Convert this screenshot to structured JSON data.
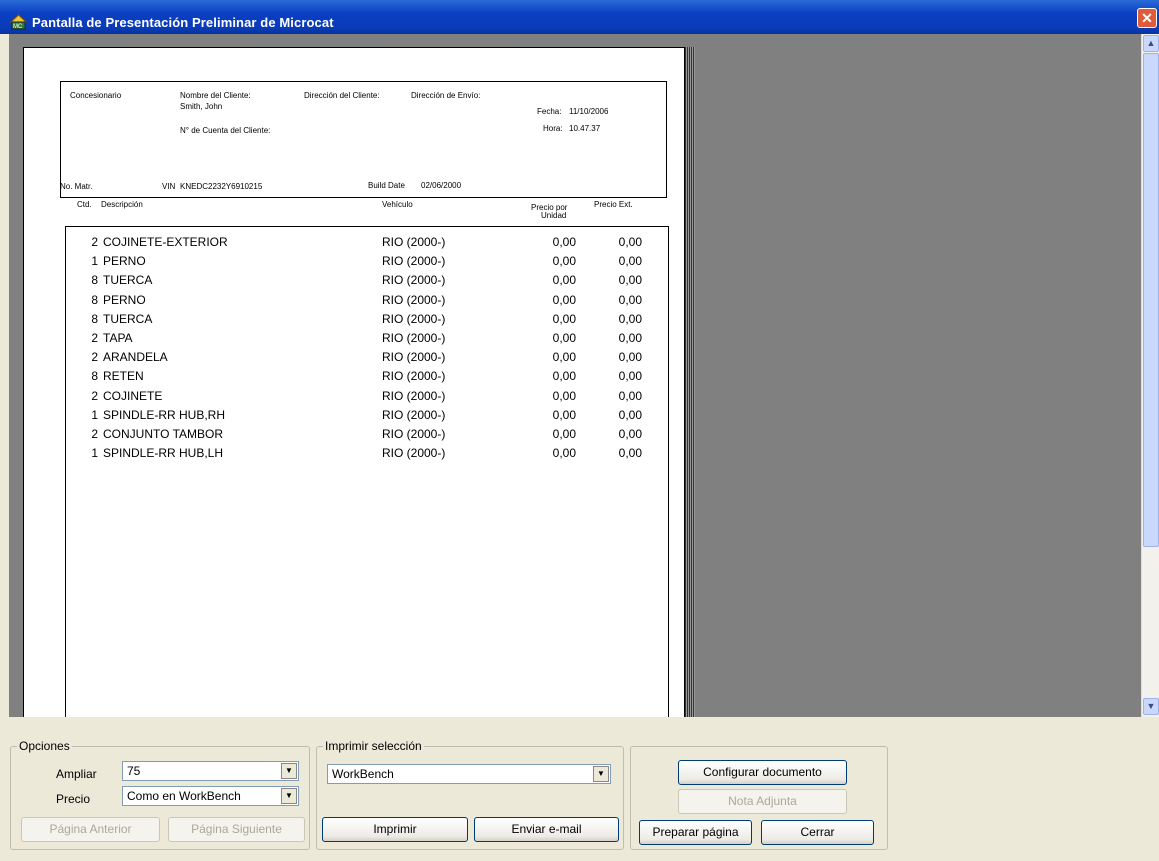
{
  "window": {
    "title": "Pantalla de Presentación Preliminar de Microcat",
    "close_label": "✕"
  },
  "doc": {
    "dealer_label": "Concesionario",
    "client_name_label": "Nombre del Cliente:",
    "client_name": "Smith, John",
    "client_address_label": "Dirección del Cliente:",
    "ship_address_label": "Dirección de Envío:",
    "account_label": "N° de Cuenta del Cliente:",
    "date_label": "Fecha:",
    "date_value": "11/10/2006",
    "time_label": "Hora:",
    "time_value": "10.47.37",
    "reg_label": "No. Matr.",
    "vin_label": "VIN",
    "vin_value": "KNEDC2232Y6910215",
    "build_label": "Build Date",
    "build_value": "02/06/2000",
    "col_qty": "Ctd.",
    "col_desc": "Descripción",
    "col_vehicle": "Vehículo",
    "col_unit_price_1": "Precio por",
    "col_unit_price_2": "Unidad",
    "col_ext_price": "Precio Ext.",
    "items": [
      {
        "qty": "2",
        "desc": "COJINETE-EXTERIOR",
        "vehicle": "RIO (2000-)",
        "unit": "0,00",
        "ext": "0,00"
      },
      {
        "qty": "1",
        "desc": "PERNO",
        "vehicle": "RIO (2000-)",
        "unit": "0,00",
        "ext": "0,00"
      },
      {
        "qty": "8",
        "desc": "TUERCA",
        "vehicle": "RIO (2000-)",
        "unit": "0,00",
        "ext": "0,00"
      },
      {
        "qty": "8",
        "desc": "PERNO",
        "vehicle": "RIO (2000-)",
        "unit": "0,00",
        "ext": "0,00"
      },
      {
        "qty": "8",
        "desc": "TUERCA",
        "vehicle": "RIO (2000-)",
        "unit": "0,00",
        "ext": "0,00"
      },
      {
        "qty": "2",
        "desc": "TAPA",
        "vehicle": "RIO (2000-)",
        "unit": "0,00",
        "ext": "0,00"
      },
      {
        "qty": "2",
        "desc": "ARANDELA",
        "vehicle": "RIO (2000-)",
        "unit": "0,00",
        "ext": "0,00"
      },
      {
        "qty": "8",
        "desc": "RETEN",
        "vehicle": "RIO (2000-)",
        "unit": "0,00",
        "ext": "0,00"
      },
      {
        "qty": "2",
        "desc": "COJINETE",
        "vehicle": "RIO (2000-)",
        "unit": "0,00",
        "ext": "0,00"
      },
      {
        "qty": "1",
        "desc": "SPINDLE-RR HUB,RH",
        "vehicle": "RIO (2000-)",
        "unit": "0,00",
        "ext": "0,00"
      },
      {
        "qty": "2",
        "desc": "CONJUNTO TAMBOR",
        "vehicle": "RIO (2000-)",
        "unit": "0,00",
        "ext": "0,00"
      },
      {
        "qty": "1",
        "desc": "SPINDLE-RR HUB,LH",
        "vehicle": "RIO (2000-)",
        "unit": "0,00",
        "ext": "0,00"
      }
    ]
  },
  "options": {
    "legend": "Opciones",
    "zoom_label": "Ampliar",
    "zoom_value": "75",
    "price_label": "Precio",
    "price_value": "Como en WorkBench",
    "prev_page": "Página Anterior",
    "next_page": "Página Siguiente"
  },
  "print": {
    "legend": "Imprimir selección",
    "printer_value": "WorkBench",
    "print_button": "Imprimir",
    "email_button": "Enviar e-mail"
  },
  "actions": {
    "configure": "Configurar documento",
    "attach_note": "Nota Adjunta",
    "prepare_page": "Preparar página",
    "close": "Cerrar"
  }
}
